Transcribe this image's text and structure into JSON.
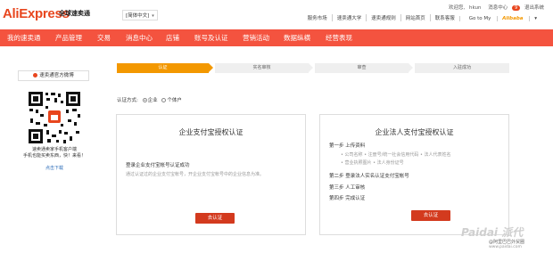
{
  "header": {
    "logo_text": "AliExpress",
    "logo_sub": "全球速卖通",
    "language": "[简体中文]",
    "welcome": "欢迎您,",
    "user": "hkun",
    "messages_label": "消息中心",
    "messages_count": "9",
    "logout": "退出系统",
    "links": [
      "服务市场",
      "速卖通大学",
      "速卖通规则",
      "网站首页",
      "联系客服"
    ],
    "go_to_prefix": "Go to My",
    "go_to_brand": "Alibaba",
    "go_to_suffix": "▾"
  },
  "nav": {
    "items": [
      "我的速卖通",
      "产品管理",
      "交易",
      "消息中心",
      "店铺",
      "账号及认证",
      "营销活动",
      "数据纵横",
      "经营表现"
    ]
  },
  "sidebar": {
    "official_button": "速卖通官方微博",
    "qr_caption": "速卖通卖家手机客户端\n手机也能买卖东西，快！来看！",
    "qr_link": "点击下载"
  },
  "steps": {
    "items": [
      "认证",
      "实名审核",
      "审查",
      "入驻成功"
    ],
    "active_index": 0
  },
  "auth_method": {
    "label": "认证方式:",
    "options": [
      "企业",
      "个体户"
    ],
    "selected_index": 0
  },
  "card_left": {
    "title": "企业支付宝授权认证",
    "subtitle": "登录企业支付宝帐号认证成功",
    "description": "通过认证过的企业支付宝帐号，开企业支付宝帐号中的企业信息为准。",
    "button": "去认证"
  },
  "card_right": {
    "title": "企业法人支付宝授权认证",
    "step1": "第一步 上传资料",
    "step1_notes": [
      "• 公司名称 • 注册号/统一社会信用代码 • 法人代表姓名",
      "• 营业执照图片 • 法人身份证号"
    ],
    "step2": "第二步 登录法人实名认证支付宝帐号",
    "step3": "第三步 人工审核",
    "step4": "第四步 完成认证",
    "button": "去认证"
  },
  "watermark": {
    "brand": "Paidai 派代",
    "sub": "@阿里巴巴外贸圈",
    "url": "www.paidai.com"
  },
  "colors": {
    "brand": "#e8461e",
    "nav": "#f4533f",
    "step_active": "#f39800",
    "button": "#d33a1e"
  }
}
